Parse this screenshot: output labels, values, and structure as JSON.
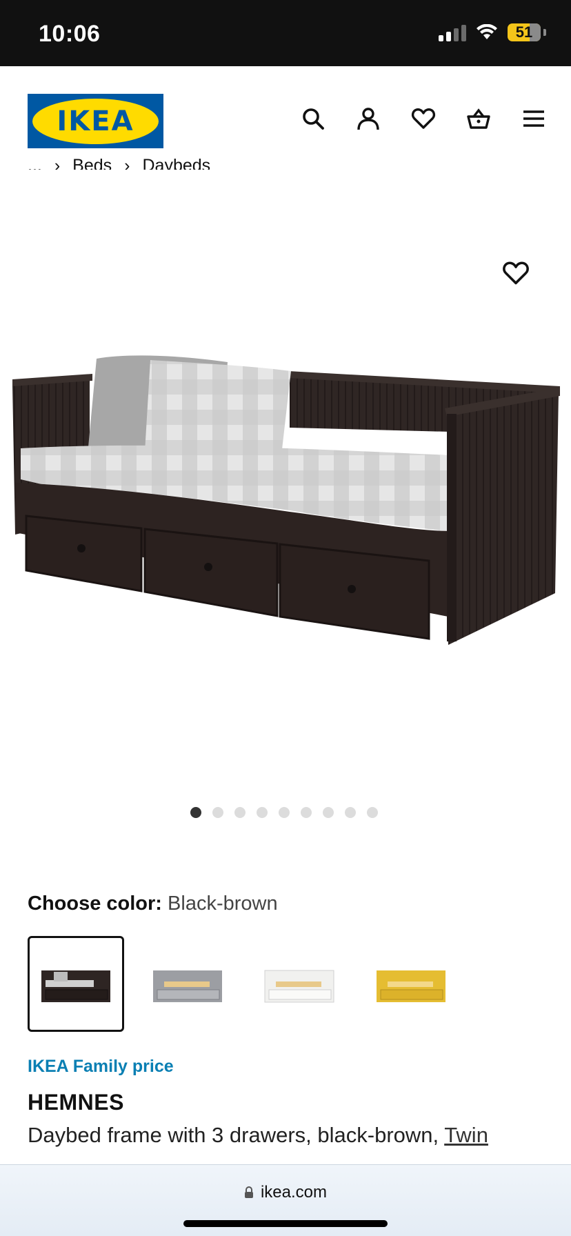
{
  "status_bar": {
    "time": "10:06",
    "battery": "51"
  },
  "header": {
    "logo_text": "IKEA",
    "icons": [
      "search-icon",
      "account-icon",
      "heart-icon",
      "basket-icon",
      "menu-icon"
    ]
  },
  "breadcrumb": {
    "ellipsis": "...",
    "items": [
      "Beds",
      "Daybeds"
    ]
  },
  "gallery": {
    "total_images": 9,
    "active_index": 0
  },
  "color_chooser": {
    "label": "Choose color:",
    "selected": "Black-brown",
    "options": [
      {
        "name": "black-brown",
        "color": "#2e2523"
      },
      {
        "name": "gray",
        "color": "#9c9ea3"
      },
      {
        "name": "white",
        "color": "#f1f1ef"
      },
      {
        "name": "yellow",
        "color": "#e5bd32"
      }
    ]
  },
  "product": {
    "family_price_label": "IKEA Family price",
    "name": "HEMNES",
    "description": "Daybed frame with 3 drawers, black-brown, ",
    "size": "Twin"
  },
  "browser": {
    "url": "ikea.com"
  },
  "colors": {
    "ikea_blue": "#0058a3",
    "ikea_yellow": "#ffdb00",
    "family_blue": "#0a7fb3"
  }
}
